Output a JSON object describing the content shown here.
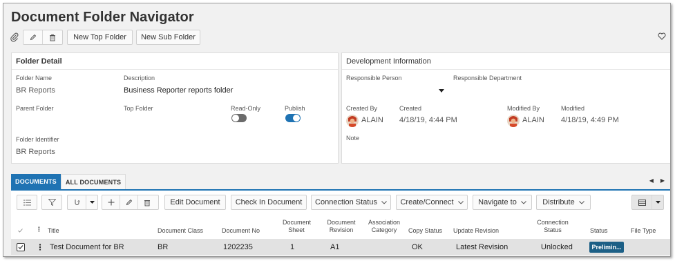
{
  "page": {
    "title": "Document Folder Navigator"
  },
  "toolbar": {
    "new_top_folder": "New Top Folder",
    "new_sub_folder": "New Sub Folder"
  },
  "folder_detail": {
    "heading": "Folder Detail",
    "folder_name_label": "Folder Name",
    "folder_name_value": "BR Reports",
    "description_label": "Description",
    "description_value": "Business Reporter reports folder",
    "parent_folder_label": "Parent Folder",
    "top_folder_label": "Top Folder",
    "read_only_label": "Read-Only",
    "read_only_on": false,
    "publish_label": "Publish",
    "publish_on": true,
    "folder_identifier_label": "Folder Identifier",
    "folder_identifier_value": "BR Reports"
  },
  "dev_info": {
    "heading": "Development Information",
    "responsible_person_label": "Responsible Person",
    "responsible_department_label": "Responsible Department",
    "created_by_label": "Created By",
    "created_by_value": "ALAIN",
    "created_label": "Created",
    "created_value": "4/18/19, 4:44 PM",
    "modified_by_label": "Modified By",
    "modified_by_value": "ALAIN",
    "modified_label": "Modified",
    "modified_value": "4/18/19, 4:49 PM",
    "note_label": "Note"
  },
  "tabs": [
    {
      "label": "DOCUMENTS",
      "active": true
    },
    {
      "label": "ALL DOCUMENTS",
      "active": false
    }
  ],
  "doc_toolbar": {
    "edit_document": "Edit Document",
    "check_in_document": "Check In Document",
    "connection_status": "Connection Status",
    "create_connect": "Create/Connect",
    "navigate_to": "Navigate to",
    "distribute": "Distribute"
  },
  "table": {
    "headers": {
      "title": "Title",
      "document_class": "Document Class",
      "document_no": "Document No",
      "document_sheet": "Document Sheet",
      "document_revision": "Document Revision",
      "association_category": "Association Category",
      "copy_status": "Copy Status",
      "update_revision": "Update Revision",
      "connection_status": "Connection Status",
      "status": "Status",
      "file_type": "File Type"
    },
    "rows": [
      {
        "title": "Test Document for BR",
        "document_class": "BR",
        "document_no": "1202235",
        "document_sheet": "1",
        "document_revision": "A1",
        "association_category": "",
        "copy_status": "OK",
        "update_revision": "Latest Revision",
        "connection_status": "Unlocked",
        "status": "Prelimin...",
        "file_type": ""
      }
    ]
  },
  "colors": {
    "accent": "#1f73b3",
    "toggle_on": "#1f73b3",
    "toggle_off": "#6b6b6b",
    "status_badge": "#1c5f86",
    "row_selected": "#e2e2e2"
  },
  "icons": [
    "paperclip-icon",
    "edit-icon",
    "delete-icon",
    "heart-icon",
    "caret-down-icon",
    "list-icon",
    "filter-icon",
    "connect-icon",
    "add-icon",
    "chevron-down-icon",
    "table-view-icon",
    "check-icon",
    "more-icon",
    "arrow-left-icon",
    "arrow-right-icon"
  ]
}
